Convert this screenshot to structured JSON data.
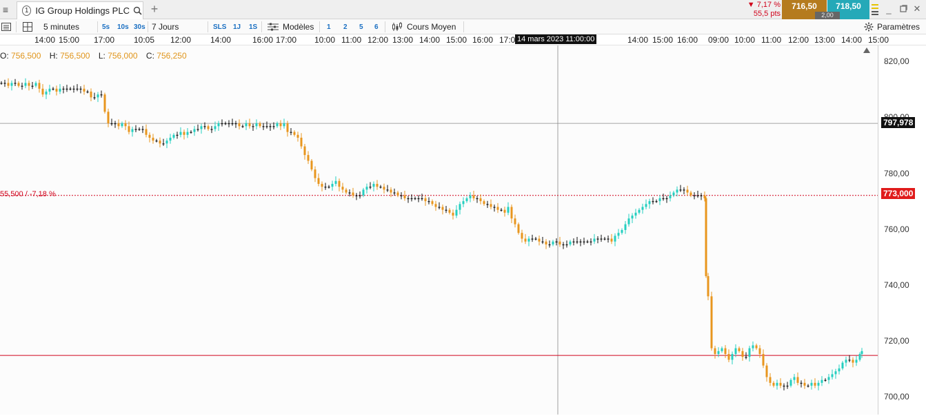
{
  "tab": {
    "number": "1",
    "title": "IG Group Holdings PLC"
  },
  "quote": {
    "change_pct": "▼ 7,17 %",
    "change_pts": "55,5 pts",
    "sell": "716,50",
    "buy": "718,50",
    "spread": "2,00"
  },
  "toolbar": {
    "interval": "5 minutes",
    "period": "7 Jours",
    "quick_intervals": [
      "5s",
      "10s",
      "30s"
    ],
    "quick_periods": [
      "SLS",
      "1J",
      "1S"
    ],
    "models_label": "Modèles",
    "models": [
      "1",
      "2",
      "5",
      "6"
    ],
    "indicator_label": "Cours Moyen",
    "settings_label": "Paramètres"
  },
  "time_axis": {
    "ticks": [
      "14:00",
      "15:00",
      "17:00",
      "10:05",
      "12:00",
      "14:00",
      "16:00",
      "17:00",
      "10:00",
      "11:00",
      "12:00",
      "13:00",
      "14:00",
      "15:00",
      "16:00",
      "17:0",
      "14:00",
      "15:00",
      "16:00",
      "09:00",
      "10:00",
      "11:00",
      "12:00",
      "13:00",
      "14:00",
      "15:00"
    ],
    "cursor_label": "14 mars 2023 11:00:00"
  },
  "ohlc": {
    "o_label": "O:",
    "o": "756,500",
    "h_label": "H:",
    "h": "756,500",
    "l_label": "L:",
    "l": "756,000",
    "c_label": "C:",
    "c": "756,250"
  },
  "prev_close_label": "55,500 / -7,18 %",
  "price_axis": {
    "ticks": [
      "820,00",
      "800,00",
      "780,00",
      "760,00",
      "740,00",
      "720,00",
      "700,00"
    ],
    "cursor_price": "797,978",
    "prev_close": "773,000"
  },
  "colors": {
    "up": "#25cfc0",
    "down": "#e8961e",
    "flat": "#111111",
    "prev_close": "#d0021b",
    "sell": "#b57b1e",
    "buy": "#25a9b8"
  },
  "chart_data": {
    "type": "candlestick",
    "ylim": [
      697,
      825
    ],
    "series": [
      {
        "x": 0,
        "y": 812
      },
      {
        "x": 5,
        "y": 812
      },
      {
        "x": 10,
        "y": 811
      },
      {
        "x": 15,
        "y": 812
      },
      {
        "x": 20,
        "y": 812
      },
      {
        "x": 25,
        "y": 811
      },
      {
        "x": 30,
        "y": 811
      },
      {
        "x": 35,
        "y": 812
      },
      {
        "x": 40,
        "y": 811
      },
      {
        "x": 45,
        "y": 811
      },
      {
        "x": 50,
        "y": 812
      },
      {
        "x": 55,
        "y": 810
      },
      {
        "x": 60,
        "y": 808
      },
      {
        "x": 65,
        "y": 809
      },
      {
        "x": 70,
        "y": 810
      },
      {
        "x": 75,
        "y": 810
      },
      {
        "x": 80,
        "y": 809
      },
      {
        "x": 85,
        "y": 810
      },
      {
        "x": 90,
        "y": 810
      },
      {
        "x": 95,
        "y": 810
      },
      {
        "x": 100,
        "y": 810
      },
      {
        "x": 105,
        "y": 810
      },
      {
        "x": 110,
        "y": 810
      },
      {
        "x": 115,
        "y": 810
      },
      {
        "x": 120,
        "y": 809
      },
      {
        "x": 125,
        "y": 809
      },
      {
        "x": 130,
        "y": 807
      },
      {
        "x": 135,
        "y": 807
      },
      {
        "x": 140,
        "y": 808
      },
      {
        "x": 145,
        "y": 808
      },
      {
        "x": 150,
        "y": 802
      },
      {
        "x": 155,
        "y": 798
      },
      {
        "x": 160,
        "y": 798
      },
      {
        "x": 165,
        "y": 798
      },
      {
        "x": 170,
        "y": 797
      },
      {
        "x": 175,
        "y": 798
      },
      {
        "x": 180,
        "y": 797
      },
      {
        "x": 185,
        "y": 795
      },
      {
        "x": 190,
        "y": 796
      },
      {
        "x": 195,
        "y": 796
      },
      {
        "x": 200,
        "y": 796
      },
      {
        "x": 205,
        "y": 796
      },
      {
        "x": 210,
        "y": 794
      },
      {
        "x": 215,
        "y": 793
      },
      {
        "x": 220,
        "y": 792
      },
      {
        "x": 225,
        "y": 792
      },
      {
        "x": 230,
        "y": 791
      },
      {
        "x": 235,
        "y": 791
      },
      {
        "x": 240,
        "y": 792
      },
      {
        "x": 245,
        "y": 793
      },
      {
        "x": 250,
        "y": 794
      },
      {
        "x": 255,
        "y": 794
      },
      {
        "x": 260,
        "y": 795
      },
      {
        "x": 265,
        "y": 794
      },
      {
        "x": 270,
        "y": 795
      },
      {
        "x": 275,
        "y": 795
      },
      {
        "x": 280,
        "y": 796
      },
      {
        "x": 285,
        "y": 796
      },
      {
        "x": 290,
        "y": 797
      },
      {
        "x": 295,
        "y": 797
      },
      {
        "x": 300,
        "y": 796
      },
      {
        "x": 305,
        "y": 796
      },
      {
        "x": 310,
        "y": 797
      },
      {
        "x": 315,
        "y": 798
      },
      {
        "x": 320,
        "y": 798
      },
      {
        "x": 325,
        "y": 798
      },
      {
        "x": 330,
        "y": 798
      },
      {
        "x": 335,
        "y": 798
      },
      {
        "x": 340,
        "y": 798
      },
      {
        "x": 345,
        "y": 797
      },
      {
        "x": 350,
        "y": 797
      },
      {
        "x": 355,
        "y": 798
      },
      {
        "x": 360,
        "y": 797
      },
      {
        "x": 365,
        "y": 797
      },
      {
        "x": 370,
        "y": 798
      },
      {
        "x": 375,
        "y": 797
      },
      {
        "x": 380,
        "y": 797
      },
      {
        "x": 385,
        "y": 797
      },
      {
        "x": 390,
        "y": 797
      },
      {
        "x": 395,
        "y": 797
      },
      {
        "x": 400,
        "y": 798
      },
      {
        "x": 405,
        "y": 797
      },
      {
        "x": 410,
        "y": 798
      },
      {
        "x": 415,
        "y": 795
      },
      {
        "x": 420,
        "y": 795
      },
      {
        "x": 425,
        "y": 794
      },
      {
        "x": 430,
        "y": 793
      },
      {
        "x": 435,
        "y": 790
      },
      {
        "x": 440,
        "y": 787
      },
      {
        "x": 445,
        "y": 785
      },
      {
        "x": 450,
        "y": 782
      },
      {
        "x": 455,
        "y": 779
      },
      {
        "x": 460,
        "y": 777
      },
      {
        "x": 465,
        "y": 776
      },
      {
        "x": 470,
        "y": 776
      },
      {
        "x": 475,
        "y": 776
      },
      {
        "x": 480,
        "y": 777
      },
      {
        "x": 485,
        "y": 778
      },
      {
        "x": 490,
        "y": 776
      },
      {
        "x": 495,
        "y": 775
      },
      {
        "x": 500,
        "y": 774
      },
      {
        "x": 505,
        "y": 774
      },
      {
        "x": 510,
        "y": 773
      },
      {
        "x": 515,
        "y": 773
      },
      {
        "x": 520,
        "y": 773
      },
      {
        "x": 525,
        "y": 775
      },
      {
        "x": 530,
        "y": 776
      },
      {
        "x": 535,
        "y": 776
      },
      {
        "x": 540,
        "y": 777
      },
      {
        "x": 545,
        "y": 776
      },
      {
        "x": 550,
        "y": 776
      },
      {
        "x": 555,
        "y": 775
      },
      {
        "x": 560,
        "y": 775
      },
      {
        "x": 565,
        "y": 774
      },
      {
        "x": 570,
        "y": 774
      },
      {
        "x": 575,
        "y": 773
      },
      {
        "x": 580,
        "y": 773
      },
      {
        "x": 585,
        "y": 772
      },
      {
        "x": 590,
        "y": 772
      },
      {
        "x": 595,
        "y": 772
      },
      {
        "x": 600,
        "y": 772
      },
      {
        "x": 605,
        "y": 772
      },
      {
        "x": 610,
        "y": 772
      },
      {
        "x": 615,
        "y": 771
      },
      {
        "x": 620,
        "y": 771
      },
      {
        "x": 625,
        "y": 770
      },
      {
        "x": 630,
        "y": 769
      },
      {
        "x": 635,
        "y": 769
      },
      {
        "x": 640,
        "y": 768
      },
      {
        "x": 645,
        "y": 768
      },
      {
        "x": 650,
        "y": 767
      },
      {
        "x": 655,
        "y": 766
      },
      {
        "x": 660,
        "y": 768
      },
      {
        "x": 665,
        "y": 770
      },
      {
        "x": 670,
        "y": 771
      },
      {
        "x": 675,
        "y": 772
      },
      {
        "x": 680,
        "y": 773
      },
      {
        "x": 685,
        "y": 772
      },
      {
        "x": 690,
        "y": 772
      },
      {
        "x": 695,
        "y": 771
      },
      {
        "x": 700,
        "y": 770
      },
      {
        "x": 705,
        "y": 770
      },
      {
        "x": 710,
        "y": 769
      },
      {
        "x": 715,
        "y": 769
      },
      {
        "x": 720,
        "y": 768
      },
      {
        "x": 725,
        "y": 768
      },
      {
        "x": 730,
        "y": 767
      },
      {
        "x": 735,
        "y": 769
      },
      {
        "x": 740,
        "y": 765
      },
      {
        "x": 745,
        "y": 763
      },
      {
        "x": 750,
        "y": 760
      },
      {
        "x": 755,
        "y": 758
      },
      {
        "x": 760,
        "y": 757
      },
      {
        "x": 765,
        "y": 758
      },
      {
        "x": 770,
        "y": 758
      },
      {
        "x": 775,
        "y": 758
      },
      {
        "x": 780,
        "y": 757
      },
      {
        "x": 785,
        "y": 757
      },
      {
        "x": 790,
        "y": 756
      },
      {
        "x": 795,
        "y": 756
      },
      {
        "x": 800,
        "y": 757
      },
      {
        "x": 805,
        "y": 757
      },
      {
        "x": 810,
        "y": 756
      },
      {
        "x": 815,
        "y": 756
      },
      {
        "x": 820,
        "y": 756
      },
      {
        "x": 825,
        "y": 757
      },
      {
        "x": 830,
        "y": 757
      },
      {
        "x": 835,
        "y": 757
      },
      {
        "x": 840,
        "y": 757
      },
      {
        "x": 845,
        "y": 757
      },
      {
        "x": 850,
        "y": 757
      },
      {
        "x": 855,
        "y": 757
      },
      {
        "x": 860,
        "y": 758
      },
      {
        "x": 865,
        "y": 758
      },
      {
        "x": 870,
        "y": 758
      },
      {
        "x": 875,
        "y": 758
      },
      {
        "x": 880,
        "y": 758
      },
      {
        "x": 885,
        "y": 757
      },
      {
        "x": 890,
        "y": 759
      },
      {
        "x": 895,
        "y": 760
      },
      {
        "x": 900,
        "y": 761
      },
      {
        "x": 905,
        "y": 763
      },
      {
        "x": 910,
        "y": 765
      },
      {
        "x": 915,
        "y": 766
      },
      {
        "x": 920,
        "y": 767
      },
      {
        "x": 925,
        "y": 768
      },
      {
        "x": 930,
        "y": 769
      },
      {
        "x": 935,
        "y": 770
      },
      {
        "x": 940,
        "y": 771
      },
      {
        "x": 945,
        "y": 771
      },
      {
        "x": 950,
        "y": 771
      },
      {
        "x": 955,
        "y": 772
      },
      {
        "x": 960,
        "y": 772
      },
      {
        "x": 965,
        "y": 772
      },
      {
        "x": 970,
        "y": 773
      },
      {
        "x": 975,
        "y": 774
      },
      {
        "x": 980,
        "y": 775
      },
      {
        "x": 985,
        "y": 775
      },
      {
        "x": 990,
        "y": 775
      },
      {
        "x": 995,
        "y": 774
      },
      {
        "x": 1000,
        "y": 773
      },
      {
        "x": 1005,
        "y": 773
      },
      {
        "x": 1010,
        "y": 773
      },
      {
        "x": 1015,
        "y": 773
      },
      {
        "x": 1020,
        "y": 772
      },
      {
        "x": 1022,
        "y": 745
      },
      {
        "x": 1025,
        "y": 738
      },
      {
        "x": 1030,
        "y": 720
      },
      {
        "x": 1035,
        "y": 718
      },
      {
        "x": 1040,
        "y": 719
      },
      {
        "x": 1045,
        "y": 720
      },
      {
        "x": 1050,
        "y": 718
      },
      {
        "x": 1055,
        "y": 716
      },
      {
        "x": 1060,
        "y": 718
      },
      {
        "x": 1065,
        "y": 720
      },
      {
        "x": 1070,
        "y": 719
      },
      {
        "x": 1075,
        "y": 717
      },
      {
        "x": 1080,
        "y": 717
      },
      {
        "x": 1085,
        "y": 720
      },
      {
        "x": 1090,
        "y": 721
      },
      {
        "x": 1095,
        "y": 720
      },
      {
        "x": 1100,
        "y": 718
      },
      {
        "x": 1105,
        "y": 714
      },
      {
        "x": 1110,
        "y": 710
      },
      {
        "x": 1115,
        "y": 708
      },
      {
        "x": 1120,
        "y": 707
      },
      {
        "x": 1125,
        "y": 708
      },
      {
        "x": 1130,
        "y": 707
      },
      {
        "x": 1135,
        "y": 707
      },
      {
        "x": 1140,
        "y": 707
      },
      {
        "x": 1145,
        "y": 709
      },
      {
        "x": 1150,
        "y": 710
      },
      {
        "x": 1155,
        "y": 708
      },
      {
        "x": 1160,
        "y": 708
      },
      {
        "x": 1165,
        "y": 707
      },
      {
        "x": 1170,
        "y": 707
      },
      {
        "x": 1175,
        "y": 708
      },
      {
        "x": 1180,
        "y": 707
      },
      {
        "x": 1185,
        "y": 708
      },
      {
        "x": 1190,
        "y": 709
      },
      {
        "x": 1195,
        "y": 709
      },
      {
        "x": 1200,
        "y": 710
      },
      {
        "x": 1205,
        "y": 711
      },
      {
        "x": 1210,
        "y": 712
      },
      {
        "x": 1215,
        "y": 713
      },
      {
        "x": 1220,
        "y": 715
      },
      {
        "x": 1225,
        "y": 716
      },
      {
        "x": 1230,
        "y": 716
      },
      {
        "x": 1235,
        "y": 715
      },
      {
        "x": 1240,
        "y": 716
      },
      {
        "x": 1245,
        "y": 718
      },
      {
        "x": 1248,
        "y": 719
      }
    ]
  }
}
